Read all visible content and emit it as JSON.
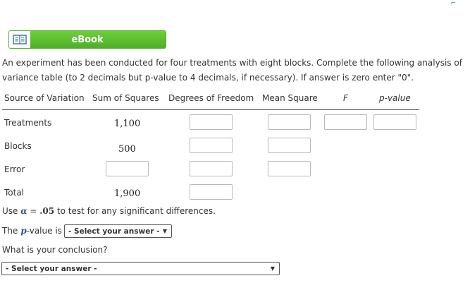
{
  "ebook": {
    "label": "eBook"
  },
  "problem": {
    "text": "An experiment has been conducted for four treatments with eight blocks. Complete the following analysis of variance table (to 2 decimals but p-value to 4 decimals, if necessary). If answer is zero enter \"0\"."
  },
  "table": {
    "headers": [
      "Source of Variation",
      "Sum of Squares",
      "Degrees of Freedom",
      "Mean Square",
      "F",
      "p-value"
    ],
    "rows": [
      {
        "label": "Treatments",
        "ss": "1,100"
      },
      {
        "label": "Blocks",
        "ss": "500"
      },
      {
        "label": "Error",
        "ss": ""
      },
      {
        "label": "Total",
        "ss": "1,900"
      }
    ]
  },
  "alpha_line": {
    "prefix": "Use",
    "symbol": "α",
    "eq": "=",
    "value": ".05",
    "suffix": "to test for any significant differences."
  },
  "pvalue_question": {
    "prefix": "The",
    "p": "p",
    "suffix": "-value is",
    "select_value": "- Select your answer -"
  },
  "conclusion": {
    "question": "What is your conclusion?",
    "select_value": "- Select your answer -"
  },
  "colors": {
    "ebook_green": "#5cbf2f",
    "text": "#333333"
  }
}
